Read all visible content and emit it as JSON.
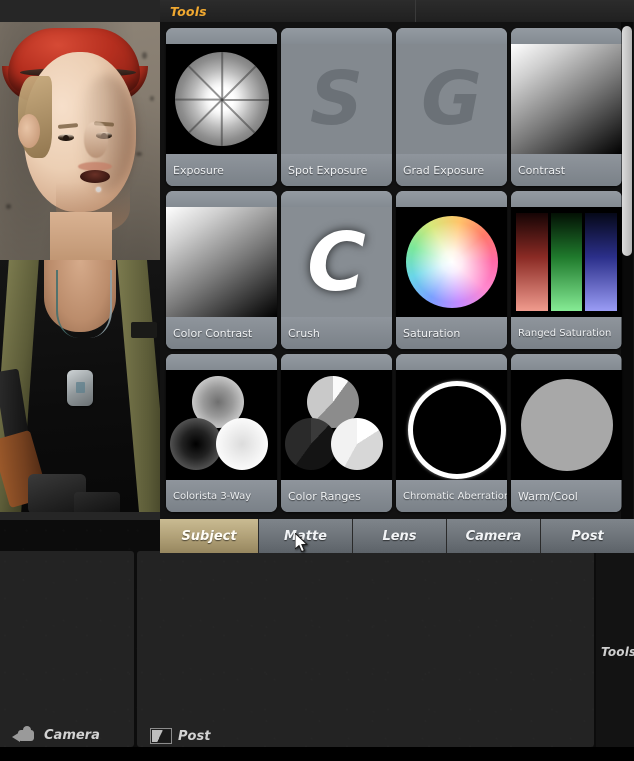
{
  "panel": {
    "title": "Tools",
    "side_label": "Tools"
  },
  "tools": [
    {
      "label": "Exposure",
      "icon": "aperture-icon"
    },
    {
      "label": "Spot Exposure",
      "icon": "letter-s-icon"
    },
    {
      "label": "Grad Exposure",
      "icon": "letter-g-icon"
    },
    {
      "label": "Contrast",
      "icon": "gradient-square-icon"
    },
    {
      "label": "Color Contrast",
      "icon": "gradient-square-icon"
    },
    {
      "label": "Crush",
      "icon": "letter-c-icon"
    },
    {
      "label": "Saturation",
      "icon": "color-wheel-icon"
    },
    {
      "label": "Ranged Saturation",
      "icon": "rgb-bars-icon"
    },
    {
      "label": "Colorista 3-Way",
      "icon": "three-spheres-icon"
    },
    {
      "label": "Color Ranges",
      "icon": "three-pies-icon"
    },
    {
      "label": "Chromatic Aberration",
      "icon": "white-ring-icon"
    },
    {
      "label": "Warm/Cool",
      "icon": "gray-disc-icon"
    }
  ],
  "tabs": [
    {
      "label": "Subject",
      "active": true
    },
    {
      "label": "Matte",
      "active": false
    },
    {
      "label": "Lens",
      "active": false
    },
    {
      "label": "Camera",
      "active": false
    },
    {
      "label": "Post",
      "active": false
    }
  ],
  "dock": [
    {
      "label": "Camera",
      "icon": "video-camera-icon"
    },
    {
      "label": "Post",
      "icon": "half-fill-square-icon"
    }
  ],
  "colors": {
    "header_accent": "#f0a830",
    "active_tab": "#b3a37a",
    "tile_face": "#848b92",
    "panel_bg": "#101010"
  }
}
